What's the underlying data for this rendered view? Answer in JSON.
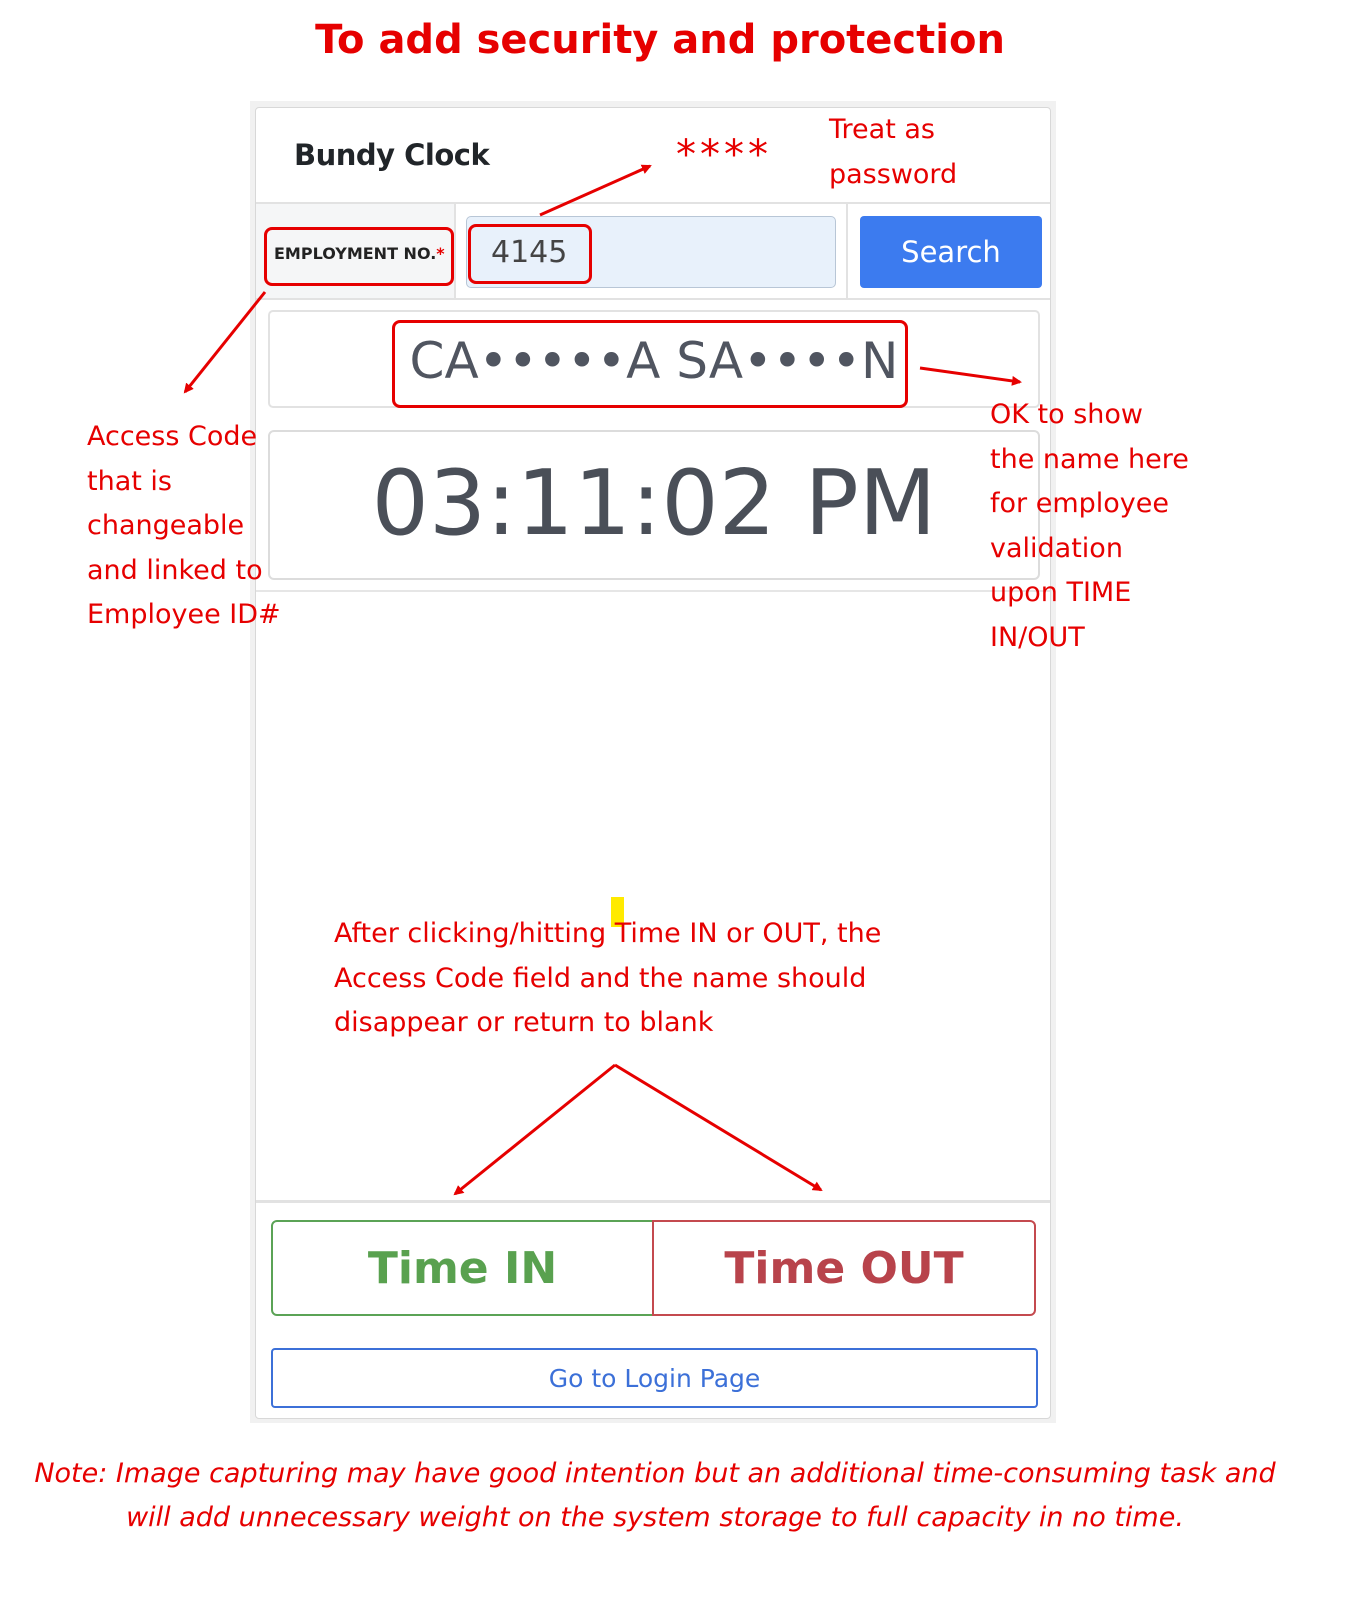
{
  "page_title": "To add security and protection",
  "app": {
    "brand": "Bundy Clock",
    "employment_label": "EMPLOYMENT NO.",
    "required_mark": "*",
    "employment_value": "4145",
    "search_label": "Search",
    "employee_name": "CA•••••A SA••••N",
    "clock_time": "03:11:02 PM",
    "time_in_label": "Time IN",
    "time_out_label": "Time OUT",
    "login_label": "Go to Login Page"
  },
  "annotations": {
    "stars": "****",
    "treat_as_password": [
      "Treat as",
      "password"
    ],
    "access_code": [
      "Access Code",
      "that is",
      "changeable",
      "and linked to",
      "Employee ID#"
    ],
    "ok_to_show": [
      "OK to show",
      "the name here",
      "for employee",
      "validation",
      "upon TIME",
      "IN/OUT"
    ],
    "after_clicking": [
      "After clicking/hitting Time IN or OUT, the",
      "Access Code field and the name should",
      "disappear or return to blank"
    ],
    "note": [
      "Note: Image capturing may have good intention but an additional time-consuming task and",
      "will add unnecessary weight on the system storage to full capacity in no time."
    ],
    "color": "#e60000"
  },
  "colors": {
    "search_bg": "#3c7bef",
    "time_in": "#59a14f",
    "time_out": "#b8434b",
    "login": "#3c70d8"
  }
}
